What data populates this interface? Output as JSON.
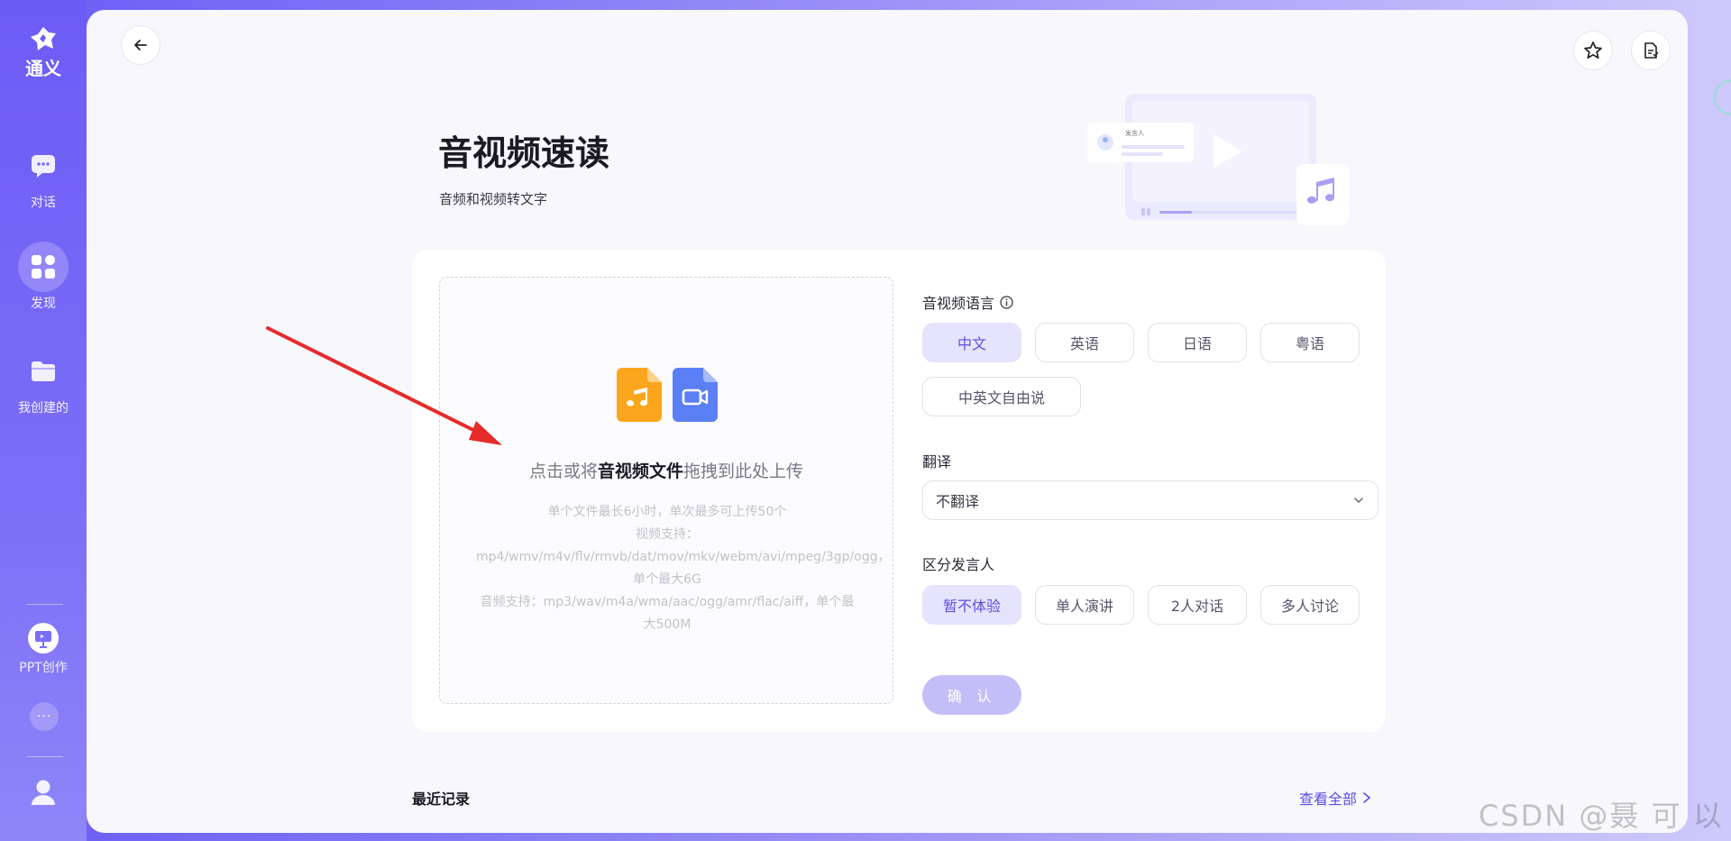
{
  "sidebar": {
    "logo_text": "通义",
    "items": [
      {
        "label": "对话",
        "icon": "chat-icon"
      },
      {
        "label": "发现",
        "icon": "grid-icon",
        "active": true
      },
      {
        "label": "我创建的",
        "icon": "folder-icon"
      },
      {
        "label": "PPT创作",
        "icon": "ppt-icon"
      }
    ],
    "more_label": "···",
    "avatar_icon": "user-icon"
  },
  "header": {
    "back_icon": "back-arrow-icon",
    "star_icon": "star-icon",
    "doc_icon": "document-icon"
  },
  "page": {
    "title": "音视频速读",
    "subtitle": "音频和视频转文字"
  },
  "illustration": {
    "caption": "发言人"
  },
  "upload": {
    "prefix": "点击或将",
    "highlight": "音视频文件",
    "suffix": "拖拽到此处上传",
    "info_lines": [
      "单个文件最长6小时，单次最多可上传50个",
      "视频支持：mp4/wmv/m4v/flv/rmvb/dat/mov/mkv/webm/avi/mpeg/3gp/ogg，单个最大6G",
      "音频支持：mp3/wav/m4a/wma/aac/ogg/amr/flac/aiff，单个最大500M"
    ]
  },
  "language": {
    "label": "音视频语言",
    "options": [
      "中文",
      "英语",
      "日语",
      "粤语",
      "中英文自由说"
    ],
    "selected": "中文"
  },
  "translate": {
    "label": "翻译",
    "value": "不翻译"
  },
  "speaker": {
    "label": "区分发言人",
    "options": [
      "暂不体验",
      "单人演讲",
      "2人对话",
      "多人讨论"
    ],
    "selected": "暂不体验"
  },
  "confirm_label": "确 认",
  "recent": {
    "title": "最近记录",
    "view_all": "查看全部"
  },
  "watermark": "CSDN @聂 可 以",
  "colors": {
    "accent": "#5b4fe0",
    "accent_light": "#e6e3fc",
    "sidebar": "#6c5cf6",
    "annotation_arrow": "#e62b2b"
  }
}
